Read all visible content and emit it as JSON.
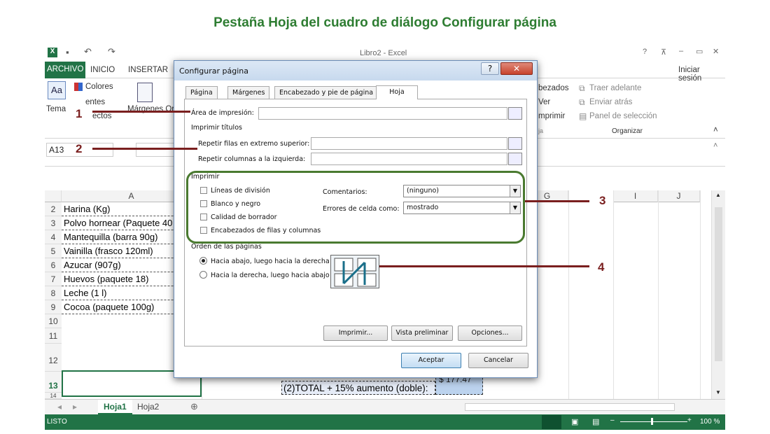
{
  "heading": "Pestaña Hoja del cuadro de diálogo Configurar página",
  "excel": {
    "title": "Libro2 - Excel",
    "tabs": [
      "ARCHIVO",
      "INICIO",
      "INSERTAR"
    ],
    "signin": "Iniciar sesión",
    "ribbon": {
      "colores": "Colores",
      "fuentes": "entes",
      "efectos": "ectos",
      "temas": "Tema",
      "margenes": "Márgenes Or",
      "encabezados": "bezados",
      "ver": "Ver",
      "imprimir": "mprimir",
      "hoja": "ja",
      "traer": "Traer adelante",
      "enviar": "Enviar atrás",
      "panel": "Panel de selección",
      "organizar": "Organizar"
    },
    "namebox": "A13",
    "columns": [
      "A",
      "G",
      "I",
      "J"
    ],
    "rows": [
      {
        "n": "2",
        "text": "Harina (Kg)"
      },
      {
        "n": "3",
        "text": "Polvo hornear (Paquete 40"
      },
      {
        "n": "4",
        "text": "Mantequilla (barra 90g)"
      },
      {
        "n": "5",
        "text": "Vainilla (frasco 120ml)"
      },
      {
        "n": "6",
        "text": "Azucar (907g)"
      },
      {
        "n": "7",
        "text": "Huevos (paquete 18)"
      },
      {
        "n": "8",
        "text": "Leche (1 l)"
      },
      {
        "n": "9",
        "text": "Cocoa (paquete 100g)"
      },
      {
        "n": "10",
        "text": ""
      },
      {
        "n": "11",
        "text": ""
      },
      {
        "n": "12",
        "text": ""
      },
      {
        "n": "13",
        "text": ""
      },
      {
        "n": "14",
        "text": ""
      }
    ],
    "total_label": "(2)TOTAL + 15% aumento (doble):",
    "total_value": "$ 177.47",
    "sheets": [
      "Hoja1",
      "Hoja2"
    ],
    "status": "LISTO",
    "zoom": "100 %"
  },
  "dialog": {
    "title": "Configurar página",
    "help": "?",
    "close": "✕",
    "tabs": [
      "Página",
      "Márgenes",
      "Encabezado y pie de página",
      "Hoja"
    ],
    "print_area_label": "Área de impresión:",
    "print_titles": "Imprimir títulos",
    "repeat_rows": "Repetir filas en extremo superior:",
    "repeat_cols": "Repetir columnas a la izquierda:",
    "print_group": "Imprimir",
    "checks": [
      "Líneas de división",
      "Blanco y negro",
      "Calidad de borrador",
      "Encabezados de filas y columnas"
    ],
    "comments_label": "Comentarios:",
    "comments_value": "(ninguno)",
    "errors_label": "Errores de celda como:",
    "errors_value": "mostrado",
    "order_group": "Orden de las páginas",
    "order_options": [
      "Hacia abajo, luego hacia la derecha",
      "Hacia la derecha, luego hacia abajo"
    ],
    "btn_print": "Imprimir...",
    "btn_preview": "Vista preliminar",
    "btn_options": "Opciones...",
    "btn_ok": "Aceptar",
    "btn_cancel": "Cancelar"
  },
  "callouts": [
    "1",
    "2",
    "3",
    "4"
  ]
}
